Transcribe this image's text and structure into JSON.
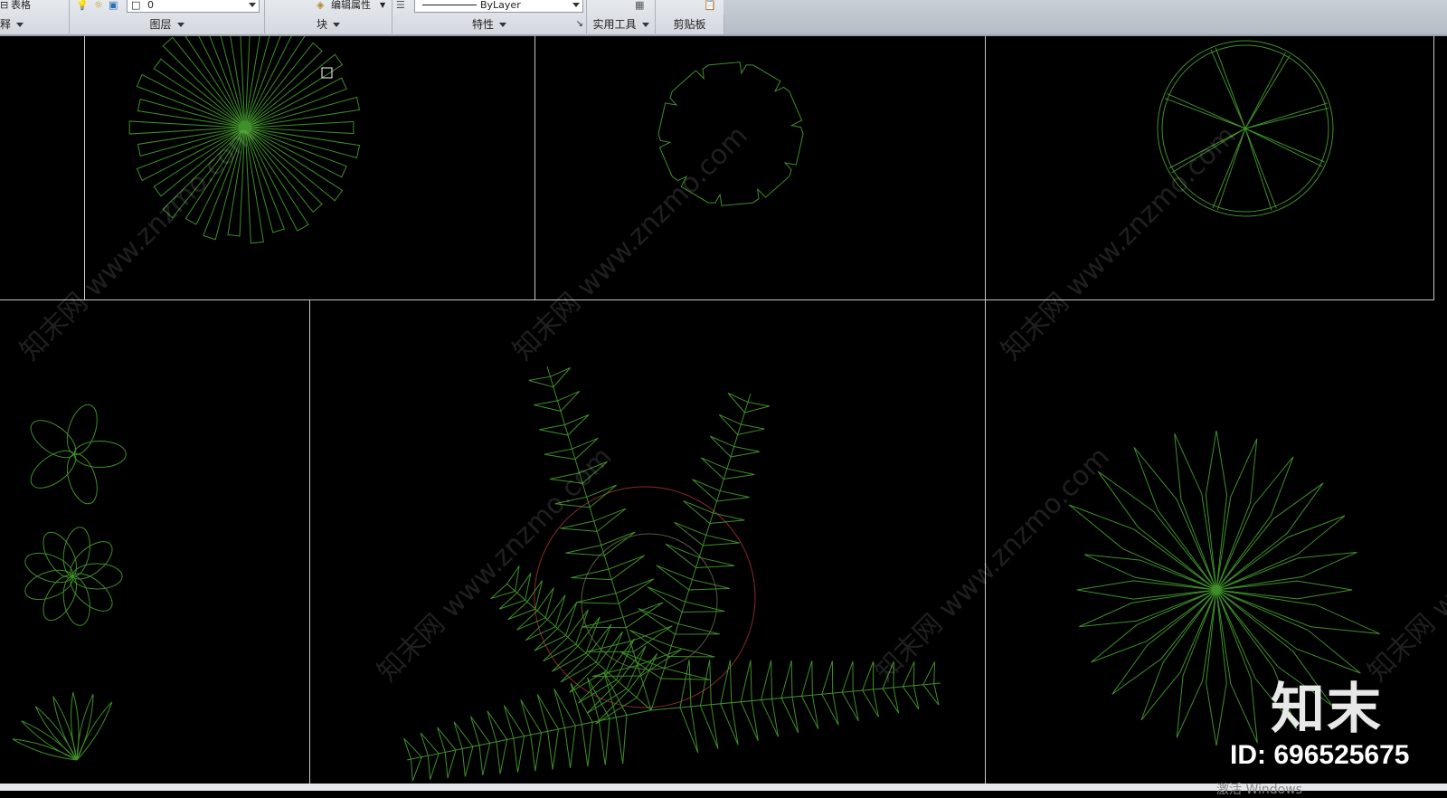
{
  "ribbon": {
    "row1": {
      "table_label": "表格",
      "layer_value": "0",
      "edit_attr_label": "编辑属性",
      "linetype_value": "ByLayer"
    },
    "panels": [
      "释",
      "图层",
      "块",
      "特性",
      "实用工具",
      "剪贴板"
    ]
  },
  "watermark": {
    "text": "知末网 www.znzmo.com"
  },
  "branding": {
    "logo_text": "知末",
    "id_text": "ID: 696525675"
  },
  "os_overlay": {
    "text": "激活 Windows"
  },
  "colors": {
    "canvas_bg": "#000000",
    "plant_line": "#3f8f2a",
    "frame_line": "#c8c8c8",
    "accent_red": "#8a2a2a"
  }
}
